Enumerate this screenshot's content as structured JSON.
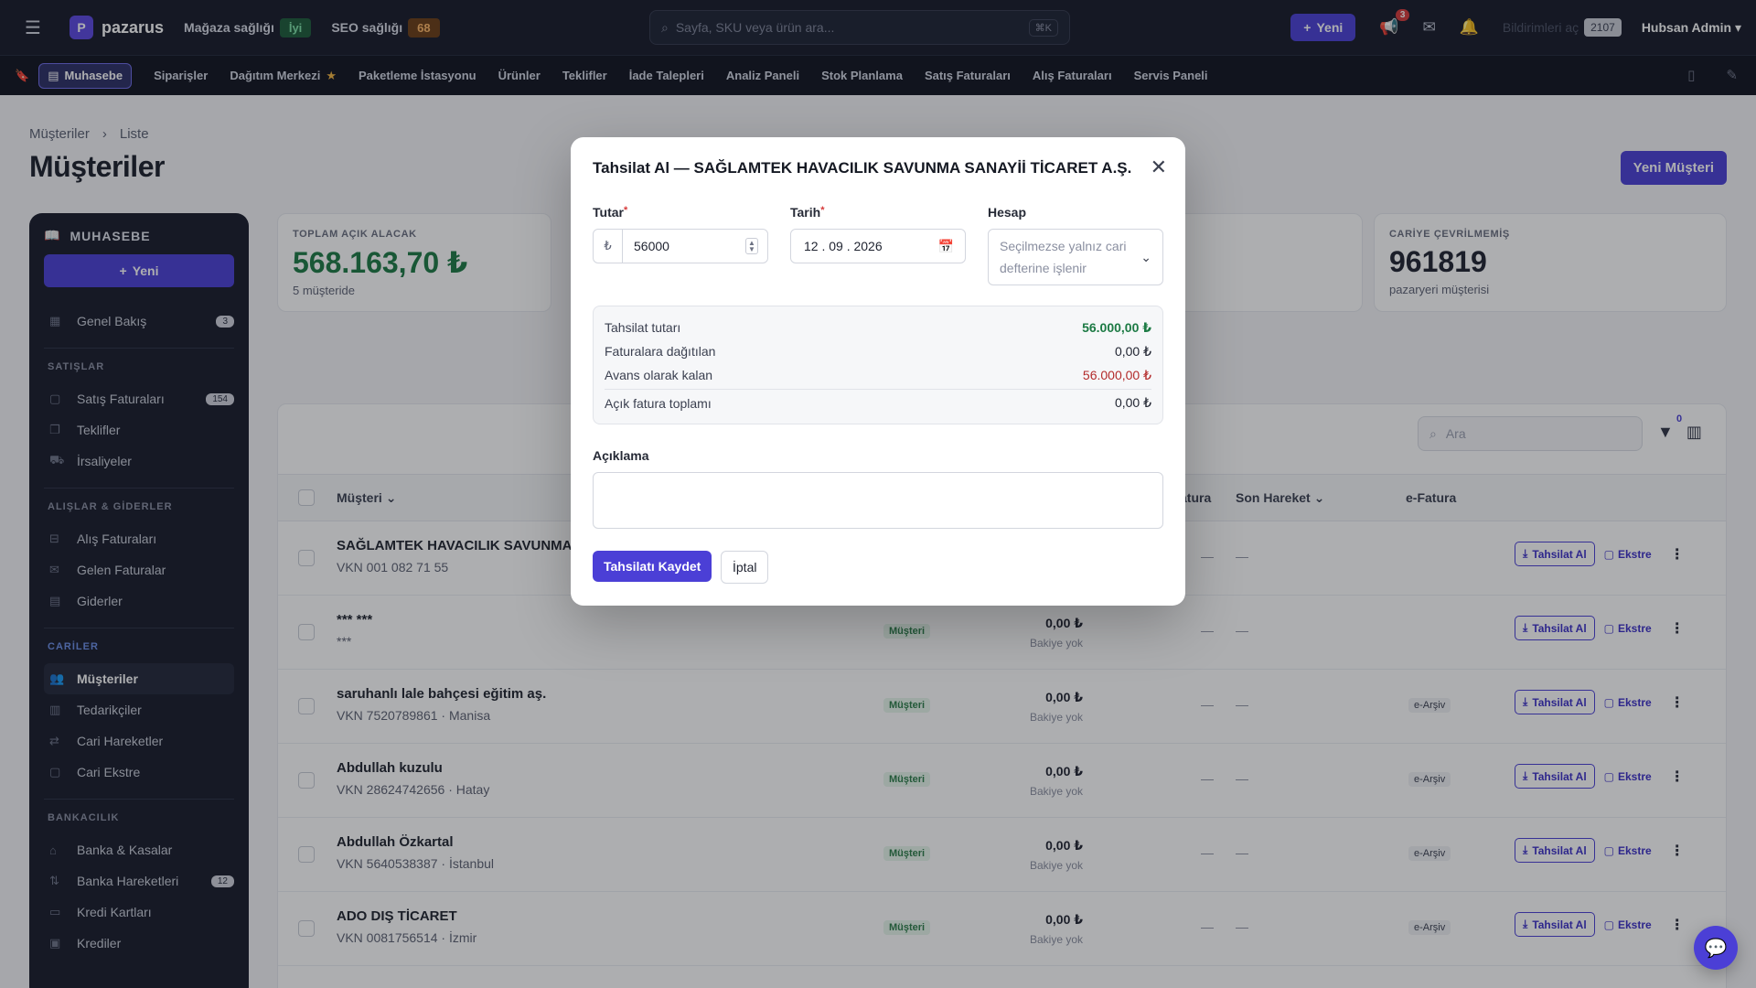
{
  "topbar": {
    "logo_letter": "P",
    "brand": "pazarus",
    "store_health_label": "Mağaza sağlığı",
    "store_health_value": "İyi",
    "seo_health_label": "SEO sağlığı",
    "seo_health_value": "68",
    "search_placeholder": "Sayfa, SKU veya ürün ara...",
    "search_shortcut": "⌘K",
    "new_label": "Yeni",
    "megaphone_badge": "3",
    "notifications_label": "Bildirimleri aç",
    "notifications_count": "2107",
    "user_name": "Hubsan Admin"
  },
  "nav": {
    "items": [
      "Muhasebe",
      "Siparişler",
      "Dağıtım Merkezi",
      "Paketleme İstasyonu",
      "Ürünler",
      "Teklifler",
      "İade Talepleri",
      "Analiz Paneli",
      "Stok Planlama",
      "Satış Faturaları",
      "Alış Faturaları",
      "Servis Paneli"
    ]
  },
  "page": {
    "breadcrumb": [
      "Müşteriler",
      "Liste"
    ],
    "title": "Müşteriler",
    "new_customer": "Yeni Müşteri"
  },
  "sidebar": {
    "title": "MUHASEBE",
    "new_label": "Yeni",
    "overview": {
      "label": "Genel Bakış",
      "count": "3"
    },
    "sections": [
      {
        "title": "SATIŞLAR",
        "items": [
          {
            "label": "Satış Faturaları",
            "count": "154"
          },
          {
            "label": "Teklifler"
          },
          {
            "label": "İrsaliyeler"
          }
        ]
      },
      {
        "title": "ALIŞLAR & GİDERLER",
        "items": [
          {
            "label": "Alış Faturaları"
          },
          {
            "label": "Gelen Faturalar"
          },
          {
            "label": "Giderler"
          }
        ]
      },
      {
        "title": "CARİLER",
        "items": [
          {
            "label": "Müşteriler"
          },
          {
            "label": "Tedarikçiler"
          },
          {
            "label": "Cari Hareketler"
          },
          {
            "label": "Cari Ekstre"
          }
        ]
      },
      {
        "title": "BANKACILIK",
        "items": [
          {
            "label": "Banka & Kasalar"
          },
          {
            "label": "Banka Hareketleri",
            "count": "12"
          },
          {
            "label": "Kredi Kartları"
          },
          {
            "label": "Krediler"
          }
        ]
      }
    ]
  },
  "kpis": {
    "open_receivable_label": "TOPLAM AÇIK ALACAK",
    "open_receivable_value": "568.163,70 ₺",
    "open_receivable_sub": "5 müşteride",
    "not_converted_label": "CARİYE ÇEVRİLMEMİŞ",
    "not_converted_value": "961819",
    "not_converted_sub": "pazaryeri müşterisi"
  },
  "table": {
    "search_placeholder": "Ara",
    "filter_count": "0",
    "headers": {
      "customer": "Müşteri",
      "invoice_partial": "atura",
      "last_move": "Son Hareket",
      "einvoice": "e-Fatura"
    },
    "rows": [
      {
        "name": "SAĞLAMTEK HAVACILIK SAVUNMA SA",
        "sub": "VKN 001 082 71 55",
        "tag": "",
        "balance": "",
        "balance_sub": "",
        "earsiv": ""
      },
      {
        "name": "*** ***",
        "sub": "***",
        "tag": "Müşteri",
        "balance": "0,00 ₺",
        "balance_sub": "Bakiye yok",
        "earsiv": ""
      },
      {
        "name": "saruhanlı lale bahçesi eğitim aş.",
        "sub": "VKN 7520789861 · Manisa",
        "tag": "Müşteri",
        "balance": "0,00 ₺",
        "balance_sub": "Bakiye yok",
        "earsiv": "e-Arşiv"
      },
      {
        "name": "Abdullah kuzulu",
        "sub": "VKN 28624742656 · Hatay",
        "tag": "Müşteri",
        "balance": "0,00 ₺",
        "balance_sub": "Bakiye yok",
        "earsiv": "e-Arşiv"
      },
      {
        "name": "Abdullah Özkartal",
        "sub": "VKN 5640538387 · İstanbul",
        "tag": "Müşteri",
        "balance": "0,00 ₺",
        "balance_sub": "Bakiye yok",
        "earsiv": "e-Arşiv"
      },
      {
        "name": "ADO DIŞ TİCARET",
        "sub": "VKN 0081756514 · İzmir",
        "tag": "Müşteri",
        "balance": "0,00 ₺",
        "balance_sub": "Bakiye yok",
        "earsiv": "e-Arşiv"
      }
    ],
    "dash": "—",
    "action_collect": "Tahsilat Al",
    "action_statement": "Ekstre"
  },
  "modal": {
    "title": "Tahsilat Al — SAĞLAMTEK HAVACILIK SAVUNMA SANAYİİ TİCARET A.Ş.",
    "amount_label": "Tutar",
    "amount_prefix": "₺",
    "amount_value": "56000",
    "date_label": "Tarih",
    "date_value": "12 . 09 . 2026",
    "account_label": "Hesap",
    "account_placeholder": "Seçilmezse yalnız cari defterine işlenir",
    "summary": {
      "collection_amount_label": "Tahsilat tutarı",
      "collection_amount_value": "56.000,00 ₺",
      "distributed_label": "Faturalara dağıtılan",
      "distributed_value": "0,00 ₺",
      "advance_label": "Avans olarak kalan",
      "advance_value": "56.000,00 ₺",
      "open_invoice_label": "Açık fatura toplamı",
      "open_invoice_value": "0,00 ₺"
    },
    "description_label": "Açıklama",
    "save_label": "Tahsilatı Kaydet",
    "cancel_label": "İptal"
  }
}
